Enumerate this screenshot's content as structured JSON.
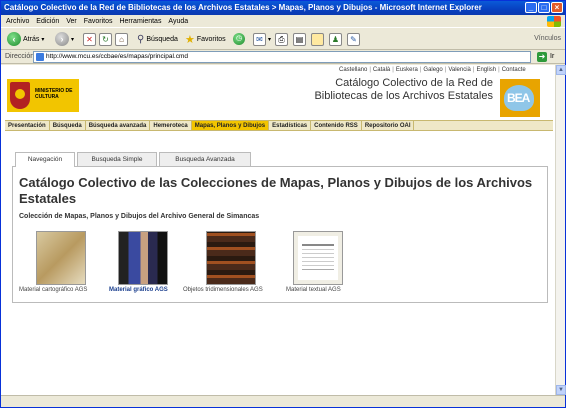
{
  "window": {
    "title": "Catálogo Colectivo de la Red de Bibliotecas de los Archivos Estatales > Mapas, Planos y Dibujos - Microsoft Internet Explorer"
  },
  "menu": [
    "Archivo",
    "Edición",
    "Ver",
    "Favoritos",
    "Herramientas",
    "Ayuda"
  ],
  "toolbar": {
    "back_label": "Atrás",
    "search_label": "Búsqueda",
    "favorites_label": "Favoritos",
    "links_label": "Vínculos"
  },
  "address": {
    "label": "Dirección",
    "url": "http://www.mcu.es/ccbae/es/mapas/principal.cmd",
    "go_label": "Ir"
  },
  "site": {
    "languages": [
      "Castellano",
      "Català",
      "Euskera",
      "Galego",
      "Valencià",
      "English",
      "Contacte"
    ],
    "ministry_logo_text": "MINISTERIO DE CULTURA",
    "title_line1": "Catálogo Colectivo de la Red de",
    "title_line2": "Bibliotecas de los Archivos Estatales",
    "bea_logo_text": "BEA",
    "nav": [
      "Presentación",
      "Búsqueda",
      "Búsqueda avanzada",
      "Hemeroteca",
      "Mapas, Planos y Dibujos",
      "Estadísticas",
      "Contenido RSS",
      "Repositorio OAI"
    ],
    "nav_active_index": 4
  },
  "tabs": [
    "Navegación",
    "Busqueda Simple",
    "Busqueda Avanzada"
  ],
  "tabs_active_index": 0,
  "main": {
    "heading": "Catálogo Colectivo de las Colecciones de Mapas, Planos y Dibujos de los Archivos Estatales",
    "subheading": "Colección de Mapas, Planos y Dibujos del Archivo General de Simancas",
    "items": [
      {
        "label": "Material cartográfico AGS"
      },
      {
        "label": "Material gráfico AGS"
      },
      {
        "label": "Objetos tridimensionales AGS"
      },
      {
        "label": "Material textual AGS"
      }
    ]
  }
}
